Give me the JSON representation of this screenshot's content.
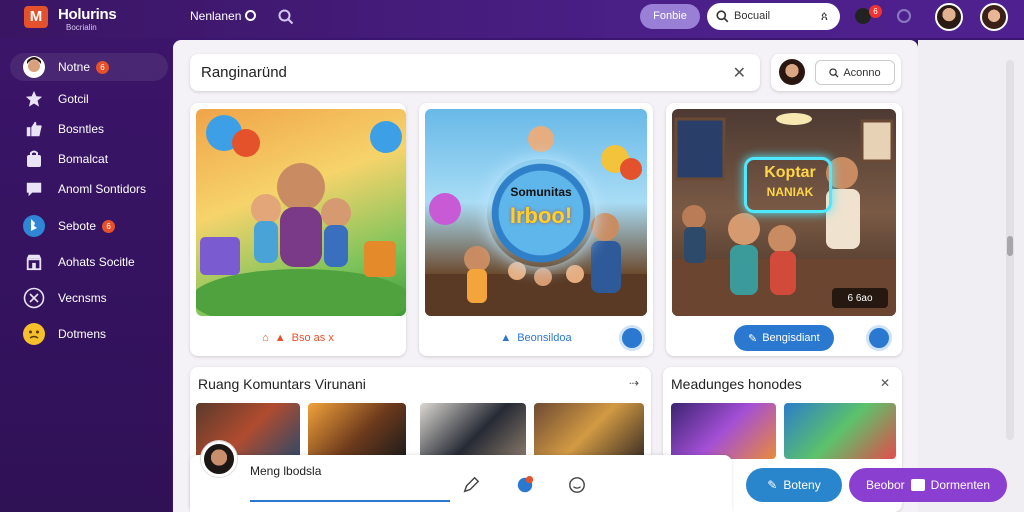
{
  "app": {
    "brand": "Holurins",
    "brand_sub": "Bocrialin"
  },
  "topbar": {
    "user_label": "Nenlanen",
    "pill_button": "Fonbie",
    "search_value": "Bocuail",
    "search_key": "ጰ",
    "notify_count": "6"
  },
  "sidebar": {
    "items": [
      {
        "label": "Notne",
        "badge": "6",
        "icon": "user-avatar-icon"
      },
      {
        "label": "Gotcil",
        "icon": "star-icon"
      },
      {
        "label": "Bosntles",
        "icon": "thumbs-up-icon"
      },
      {
        "label": "Bomalcat",
        "icon": "bag-icon"
      },
      {
        "label": "Anoml Sontidors",
        "icon": "chat-bubble-icon"
      },
      {
        "label": "Sebote",
        "badge": "6",
        "icon": "bing-icon"
      },
      {
        "label": "Aohats Socitle",
        "icon": "store-icon"
      },
      {
        "label": "Vecnsms",
        "icon": "close-circle-icon"
      },
      {
        "label": "Dotmens",
        "icon": "emoji-icon"
      }
    ]
  },
  "search": {
    "value": "Ranginaründ"
  },
  "userbox": {
    "button_label": "Aconno"
  },
  "cards": [
    {
      "footer": "Bso as x"
    },
    {
      "footer": "Beonsildoa",
      "bubble_line1": "Somunitas",
      "bubble_line2": "Irboo!"
    },
    {
      "footer": "Bengisdiant",
      "neon_line1": "Koptar",
      "neon_line2": "NANIAK",
      "tag": "6 6ao"
    }
  ],
  "sections": [
    {
      "title": "Ruang Komuntars Virunani"
    },
    {
      "title": "Meadunges honodes"
    }
  ],
  "composer": {
    "placeholder": "Meng lbodsla"
  },
  "actions": {
    "blue_label": "Boteny",
    "purple_label_1": "Beobor",
    "purple_label_2": "Dormenten"
  },
  "colors": {
    "accent_purple": "#8a3fd0",
    "accent_blue": "#2a86cc",
    "sidebar_bg": "#3b1569"
  }
}
